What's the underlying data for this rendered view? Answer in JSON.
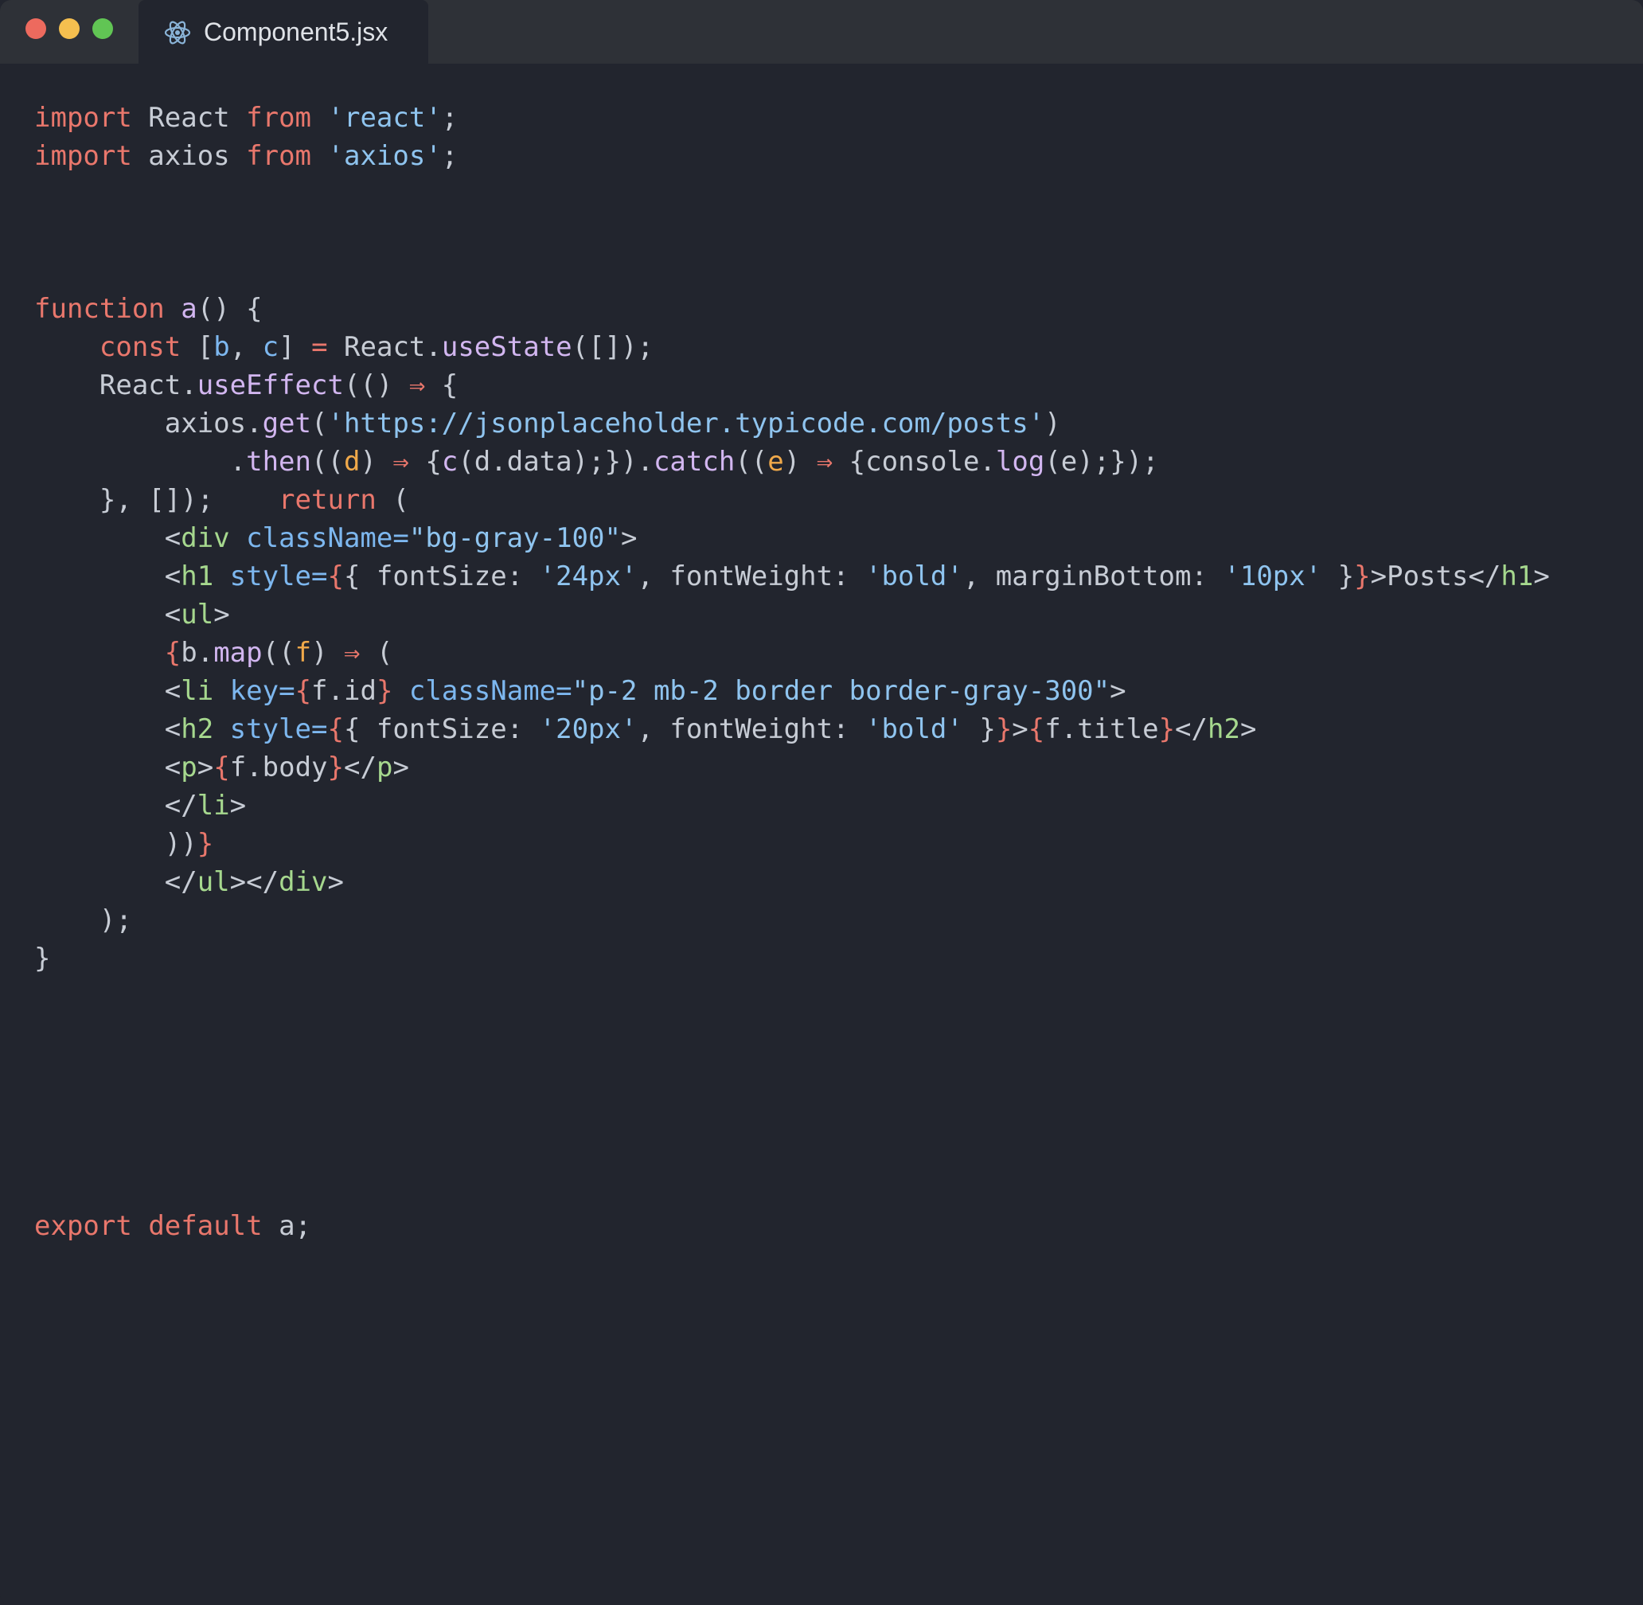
{
  "window": {
    "controls": [
      "close",
      "minimize",
      "maximize"
    ]
  },
  "tab": {
    "title": "Component5.jsx",
    "icon": "react-icon"
  },
  "editor": {
    "language": "jsx",
    "lines": [
      [
        {
          "t": "import",
          "c": "kw"
        },
        {
          "t": " React ",
          "c": "pl"
        },
        {
          "t": "from",
          "c": "kw"
        },
        {
          "t": " ",
          "c": "pl"
        },
        {
          "t": "'react'",
          "c": "str"
        },
        {
          "t": ";",
          "c": "pl"
        }
      ],
      [
        {
          "t": "import",
          "c": "kw"
        },
        {
          "t": " axios ",
          "c": "pl"
        },
        {
          "t": "from",
          "c": "kw"
        },
        {
          "t": " ",
          "c": "pl"
        },
        {
          "t": "'axios'",
          "c": "str"
        },
        {
          "t": ";",
          "c": "pl"
        }
      ],
      [],
      [],
      [],
      [
        {
          "t": "function",
          "c": "kw"
        },
        {
          "t": " ",
          "c": "pl"
        },
        {
          "t": "a",
          "c": "fn"
        },
        {
          "t": "() {",
          "c": "pl"
        }
      ],
      [
        {
          "t": "    ",
          "c": "pl"
        },
        {
          "t": "const",
          "c": "kw"
        },
        {
          "t": " [",
          "c": "pl"
        },
        {
          "t": "b",
          "c": "var"
        },
        {
          "t": ", ",
          "c": "pl"
        },
        {
          "t": "c",
          "c": "var"
        },
        {
          "t": "] ",
          "c": "pl"
        },
        {
          "t": "=",
          "c": "kw"
        },
        {
          "t": " React.",
          "c": "pl"
        },
        {
          "t": "useState",
          "c": "fn"
        },
        {
          "t": "([]);",
          "c": "pl"
        }
      ],
      [
        {
          "t": "    React.",
          "c": "pl"
        },
        {
          "t": "useEffect",
          "c": "fn"
        },
        {
          "t": "(() ",
          "c": "pl"
        },
        {
          "t": "⇒",
          "c": "kw"
        },
        {
          "t": " {",
          "c": "pl"
        }
      ],
      [
        {
          "t": "        axios.",
          "c": "pl"
        },
        {
          "t": "get",
          "c": "fn"
        },
        {
          "t": "(",
          "c": "pl"
        },
        {
          "t": "'https://jsonplaceholder.typicode.com/posts'",
          "c": "str"
        },
        {
          "t": ")",
          "c": "pl"
        }
      ],
      [
        {
          "t": "            .",
          "c": "pl"
        },
        {
          "t": "then",
          "c": "fn"
        },
        {
          "t": "((",
          "c": "pl"
        },
        {
          "t": "d",
          "c": "param"
        },
        {
          "t": ") ",
          "c": "pl"
        },
        {
          "t": "⇒",
          "c": "kw"
        },
        {
          "t": " {",
          "c": "pl"
        },
        {
          "t": "c",
          "c": "fn"
        },
        {
          "t": "(d.data);}).",
          "c": "pl"
        },
        {
          "t": "catch",
          "c": "fn"
        },
        {
          "t": "((",
          "c": "pl"
        },
        {
          "t": "e",
          "c": "param"
        },
        {
          "t": ") ",
          "c": "pl"
        },
        {
          "t": "⇒",
          "c": "kw"
        },
        {
          "t": " {console.",
          "c": "pl"
        },
        {
          "t": "log",
          "c": "fn"
        },
        {
          "t": "(e);});",
          "c": "pl"
        }
      ],
      [
        {
          "t": "    }, []);    ",
          "c": "pl"
        },
        {
          "t": "return",
          "c": "kw"
        },
        {
          "t": " (",
          "c": "pl"
        }
      ],
      [
        {
          "t": "        <",
          "c": "pl"
        },
        {
          "t": "div",
          "c": "tag"
        },
        {
          "t": " ",
          "c": "pl"
        },
        {
          "t": "className=",
          "c": "attr"
        },
        {
          "t": "\"bg-gray-100\"",
          "c": "str"
        },
        {
          "t": ">",
          "c": "pl"
        }
      ],
      [
        {
          "t": "        <",
          "c": "pl"
        },
        {
          "t": "h1",
          "c": "tag"
        },
        {
          "t": " ",
          "c": "pl"
        },
        {
          "t": "style=",
          "c": "attr"
        },
        {
          "t": "{",
          "c": "br"
        },
        {
          "t": "{ fontSize: ",
          "c": "pl"
        },
        {
          "t": "'24px'",
          "c": "str"
        },
        {
          "t": ", fontWeight: ",
          "c": "pl"
        },
        {
          "t": "'bold'",
          "c": "str"
        },
        {
          "t": ", marginBottom: ",
          "c": "pl"
        },
        {
          "t": "'10px'",
          "c": "str"
        },
        {
          "t": " }",
          "c": "pl"
        },
        {
          "t": "}",
          "c": "br"
        },
        {
          "t": ">Posts</",
          "c": "pl"
        },
        {
          "t": "h1",
          "c": "tag"
        },
        {
          "t": ">",
          "c": "pl"
        }
      ],
      [
        {
          "t": "        <",
          "c": "pl"
        },
        {
          "t": "ul",
          "c": "tag"
        },
        {
          "t": ">",
          "c": "pl"
        }
      ],
      [
        {
          "t": "        ",
          "c": "pl"
        },
        {
          "t": "{",
          "c": "br"
        },
        {
          "t": "b.",
          "c": "pl"
        },
        {
          "t": "map",
          "c": "fn"
        },
        {
          "t": "((",
          "c": "pl"
        },
        {
          "t": "f",
          "c": "param"
        },
        {
          "t": ") ",
          "c": "pl"
        },
        {
          "t": "⇒",
          "c": "kw"
        },
        {
          "t": " (",
          "c": "pl"
        }
      ],
      [
        {
          "t": "        <",
          "c": "pl"
        },
        {
          "t": "li",
          "c": "tag"
        },
        {
          "t": " ",
          "c": "pl"
        },
        {
          "t": "key=",
          "c": "attr"
        },
        {
          "t": "{",
          "c": "br"
        },
        {
          "t": "f.id",
          "c": "pl"
        },
        {
          "t": "}",
          "c": "br"
        },
        {
          "t": " ",
          "c": "pl"
        },
        {
          "t": "className=",
          "c": "attr"
        },
        {
          "t": "\"p-2 mb-2 border border-gray-300\"",
          "c": "str"
        },
        {
          "t": ">",
          "c": "pl"
        }
      ],
      [
        {
          "t": "        <",
          "c": "pl"
        },
        {
          "t": "h2",
          "c": "tag"
        },
        {
          "t": " ",
          "c": "pl"
        },
        {
          "t": "style=",
          "c": "attr"
        },
        {
          "t": "{",
          "c": "br"
        },
        {
          "t": "{ fontSize: ",
          "c": "pl"
        },
        {
          "t": "'20px'",
          "c": "str"
        },
        {
          "t": ", fontWeight: ",
          "c": "pl"
        },
        {
          "t": "'bold'",
          "c": "str"
        },
        {
          "t": " }",
          "c": "pl"
        },
        {
          "t": "}",
          "c": "br"
        },
        {
          "t": ">",
          "c": "pl"
        },
        {
          "t": "{",
          "c": "br"
        },
        {
          "t": "f.title",
          "c": "pl"
        },
        {
          "t": "}",
          "c": "br"
        },
        {
          "t": "</",
          "c": "pl"
        },
        {
          "t": "h2",
          "c": "tag"
        },
        {
          "t": ">",
          "c": "pl"
        }
      ],
      [
        {
          "t": "        <",
          "c": "pl"
        },
        {
          "t": "p",
          "c": "tag"
        },
        {
          "t": ">",
          "c": "pl"
        },
        {
          "t": "{",
          "c": "br"
        },
        {
          "t": "f.body",
          "c": "pl"
        },
        {
          "t": "}",
          "c": "br"
        },
        {
          "t": "</",
          "c": "pl"
        },
        {
          "t": "p",
          "c": "tag"
        },
        {
          "t": ">",
          "c": "pl"
        }
      ],
      [
        {
          "t": "        </",
          "c": "pl"
        },
        {
          "t": "li",
          "c": "tag"
        },
        {
          "t": ">",
          "c": "pl"
        }
      ],
      [
        {
          "t": "        ))",
          "c": "pl"
        },
        {
          "t": "}",
          "c": "br"
        }
      ],
      [
        {
          "t": "        </",
          "c": "pl"
        },
        {
          "t": "ul",
          "c": "tag"
        },
        {
          "t": "></",
          "c": "pl"
        },
        {
          "t": "div",
          "c": "tag"
        },
        {
          "t": ">",
          "c": "pl"
        }
      ],
      [
        {
          "t": "    );",
          "c": "pl"
        }
      ],
      [
        {
          "t": "}",
          "c": "pl"
        }
      ],
      [],
      [],
      [],
      [],
      [],
      [],
      [
        {
          "t": "export",
          "c": "kw"
        },
        {
          "t": " ",
          "c": "pl"
        },
        {
          "t": "default",
          "c": "kw"
        },
        {
          "t": " a;",
          "c": "pl"
        }
      ]
    ]
  }
}
